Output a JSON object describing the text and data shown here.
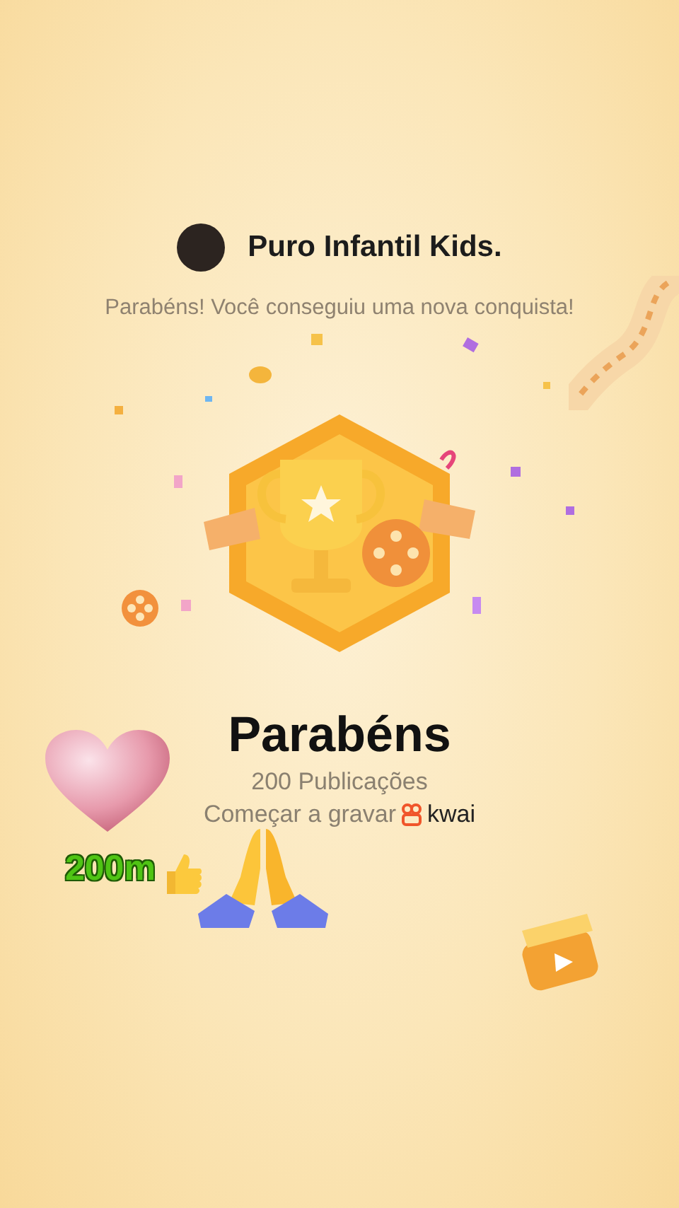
{
  "header": {
    "channel_name": "Puro Infantil Kids.",
    "subtitle": "Parabéns! Você conseguiu uma nova conquista!"
  },
  "achievement": {
    "title": "Parabéns",
    "count_label": "200 Publicações"
  },
  "record_prompt": {
    "label": "Começar a gravar",
    "brand": "kwai"
  },
  "stickers": [
    {
      "kind": "heart"
    },
    {
      "kind": "caption",
      "text": "200m"
    },
    {
      "kind": "praying-hands"
    }
  ]
}
